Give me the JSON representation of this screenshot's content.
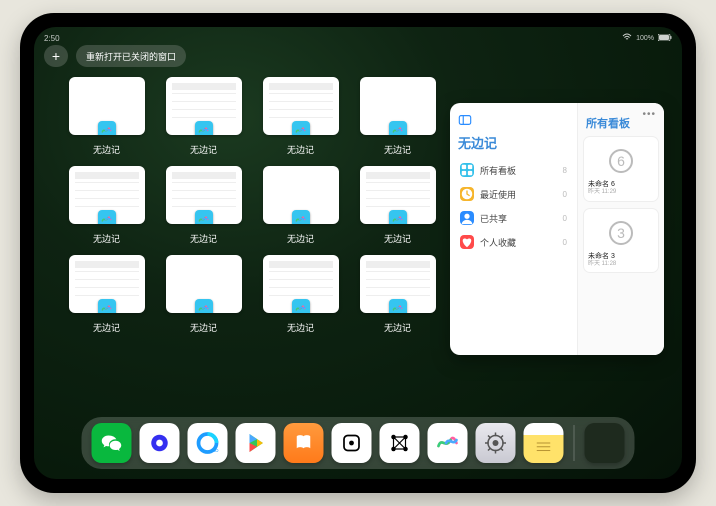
{
  "status": {
    "left": "2:50",
    "battery": "100%"
  },
  "top": {
    "plus": "+",
    "reopen_label": "重新打开已关闭的窗口"
  },
  "app_switcher": {
    "app_name": "无边记",
    "cards": [
      {
        "label": "无边记",
        "style": "blank"
      },
      {
        "label": "无边记",
        "style": "cal"
      },
      {
        "label": "无边记",
        "style": "cal"
      },
      {
        "label": "无边记",
        "style": "blank"
      },
      {
        "label": "无边记",
        "style": "cal"
      },
      {
        "label": "无边记",
        "style": "cal"
      },
      {
        "label": "无边记",
        "style": "blank"
      },
      {
        "label": "无边记",
        "style": "cal"
      },
      {
        "label": "无边记",
        "style": "cal"
      },
      {
        "label": "无边记",
        "style": "blank"
      },
      {
        "label": "无边记",
        "style": "cal"
      },
      {
        "label": "无边记",
        "style": "cal"
      }
    ]
  },
  "preview": {
    "title": "无边记",
    "side_title": "所有看板",
    "items": [
      {
        "icon": "grid",
        "color": "#34c0ea",
        "label": "所有看板",
        "count": "8"
      },
      {
        "icon": "clock",
        "color": "#f6b52c",
        "label": "最近使用",
        "count": "0"
      },
      {
        "icon": "person",
        "color": "#2a8cff",
        "label": "已共享",
        "count": "0"
      },
      {
        "icon": "heart",
        "color": "#ff4a4a",
        "label": "个人收藏",
        "count": "0"
      }
    ],
    "boards": [
      {
        "digit": "6",
        "name": "未命名 6",
        "date": "昨天 11:29"
      },
      {
        "digit": "3",
        "name": "未命名 3",
        "date": "昨天 11:28"
      }
    ]
  },
  "dock": {
    "apps": [
      {
        "name": "wechat"
      },
      {
        "name": "quark"
      },
      {
        "name": "qqbrowser"
      },
      {
        "name": "play"
      },
      {
        "name": "books"
      },
      {
        "name": "dice"
      },
      {
        "name": "graph"
      },
      {
        "name": "freeform"
      },
      {
        "name": "settings"
      },
      {
        "name": "notes"
      }
    ],
    "folder": {
      "minis": [
        "#2a8cff",
        "#34c759",
        "#ff9500",
        "#0a84ff"
      ]
    }
  }
}
